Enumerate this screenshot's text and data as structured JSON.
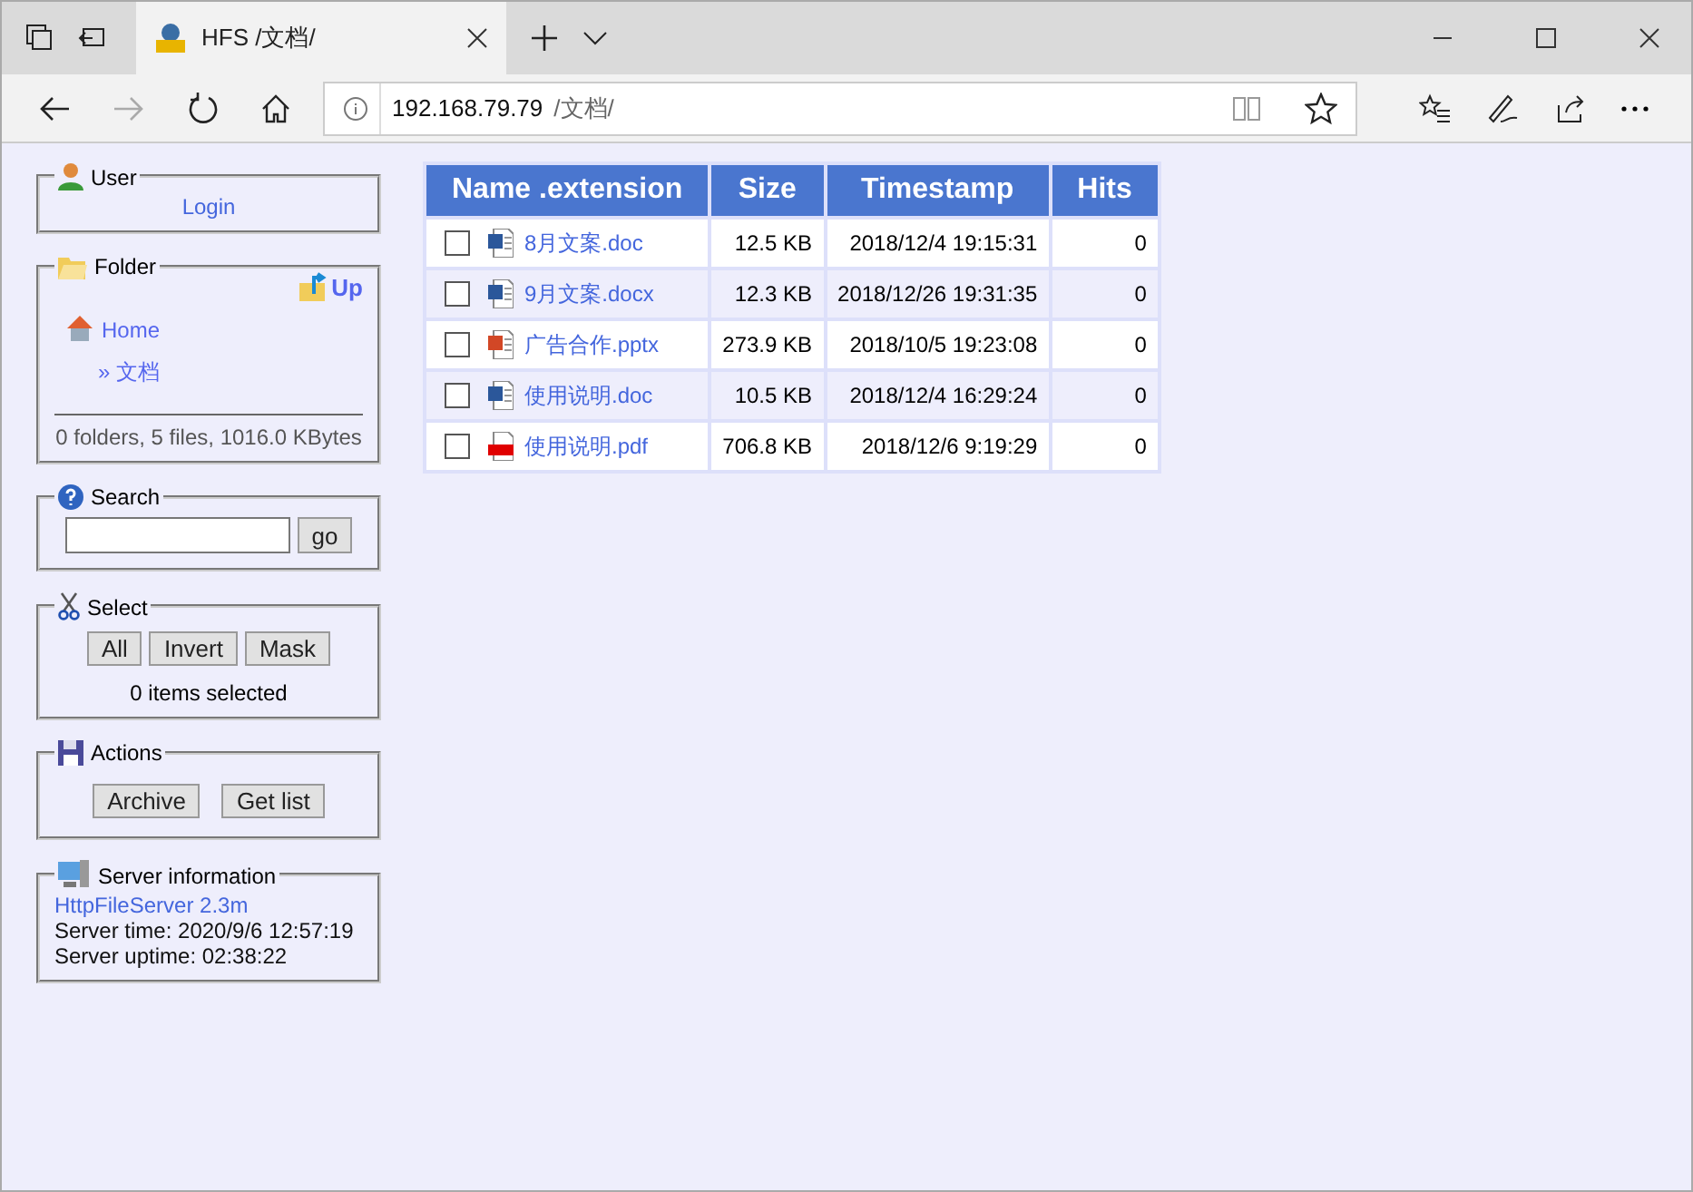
{
  "browser": {
    "tab": {
      "title": "HFS /文档/",
      "selected": true
    },
    "address": {
      "host": "192.168.79.79",
      "path": "/文档/"
    }
  },
  "user": {
    "legend": "User",
    "login": "Login"
  },
  "folder": {
    "legend": "Folder",
    "up": "Up",
    "home": "Home",
    "path": "» 文档",
    "summary": "0 folders, 5 files, 1016.0 KBytes"
  },
  "search": {
    "legend": "Search",
    "button": "go"
  },
  "select": {
    "legend": "Select",
    "buttons": [
      "All",
      "Invert",
      "Mask"
    ],
    "status": "0 items selected"
  },
  "actions": {
    "legend": "Actions",
    "buttons": [
      "Archive",
      "Get list"
    ]
  },
  "server": {
    "legend": "Server information",
    "link": "HttpFileServer 2.3m",
    "time": "Server time: 2020/9/6 12:57:19",
    "uptime": "Server uptime: 02:38:22"
  },
  "table": {
    "columns": [
      "Name .extension",
      "Size",
      "Timestamp",
      "Hits"
    ],
    "rows": [
      {
        "kind": "word",
        "name": "8月文案.doc",
        "size": "12.5 KB",
        "timestamp": "2018/12/4 19:15:31",
        "hits": "0",
        "checked": false
      },
      {
        "kind": "word",
        "name": "9月文案.docx",
        "size": "12.3 KB",
        "timestamp": "2018/12/26 19:31:35",
        "hits": "0",
        "checked": false
      },
      {
        "kind": "powerpoint",
        "name": "广告合作.pptx",
        "size": "273.9 KB",
        "timestamp": "2018/10/5 19:23:08",
        "hits": "0",
        "checked": false
      },
      {
        "kind": "word",
        "name": "使用说明.doc",
        "size": "10.5 KB",
        "timestamp": "2018/12/4 16:29:24",
        "hits": "0",
        "checked": false
      },
      {
        "kind": "pdf",
        "name": "使用说明.pdf",
        "size": "706.8 KB",
        "timestamp": "2018/12/6 9:19:29",
        "hits": "0",
        "checked": false
      }
    ]
  }
}
